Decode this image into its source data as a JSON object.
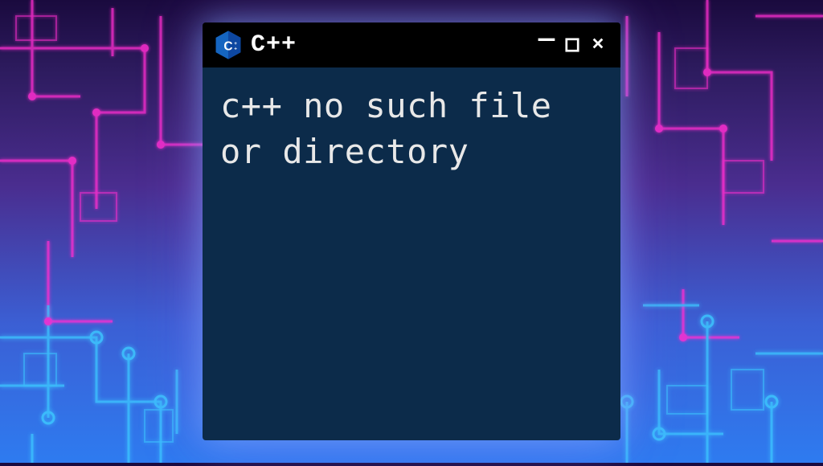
{
  "window": {
    "title": "C++",
    "icon_name": "cpp-logo-icon"
  },
  "content": {
    "text": "c++ no such file or directory"
  },
  "controls": {
    "minimize": "—",
    "close": "✕"
  },
  "colors": {
    "titlebar_bg": "#000000",
    "content_bg": "#0c2b4a",
    "text": "#e8e8e8",
    "title_text": "#ffffff",
    "icon_blue": "#1565c0"
  }
}
